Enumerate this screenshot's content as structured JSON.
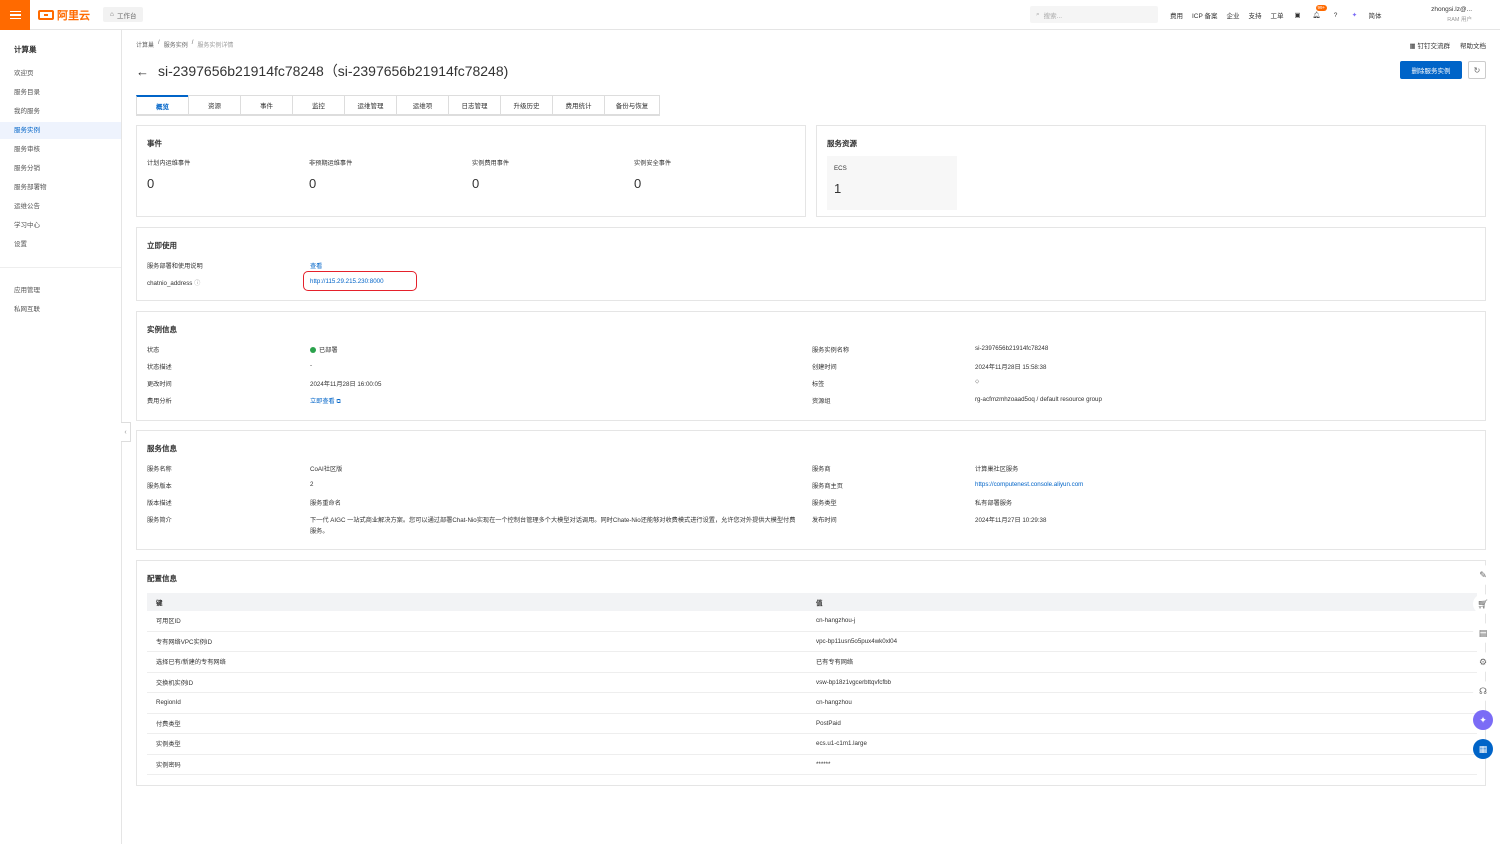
{
  "topbar": {
    "logo_text": "阿里云",
    "workbench_label": "工作台",
    "search_placeholder": "搜索...",
    "nav": [
      "费用",
      "ICP 备案",
      "企业",
      "支持",
      "工单"
    ],
    "notify_badge": "99+",
    "lang": "简体",
    "user_name": "zhongsi.lz@...",
    "user_role": "RAM 用户"
  },
  "sidebar": {
    "title": "计算巢",
    "items": [
      "欢迎页",
      "服务目录",
      "我的服务",
      "服务实例",
      "服务审核",
      "服务分销",
      "服务部署物",
      "运维公告",
      "学习中心",
      "设置"
    ],
    "active_index": 3,
    "extra_items": [
      "应用管理",
      "私网互联"
    ]
  },
  "breadcrumb": [
    "计算巢",
    "服务实例",
    "服务实例详情"
  ],
  "header_links": [
    "钉钉交流群",
    "帮助文档"
  ],
  "page_title": "si-2397656b21914fc78248（si-2397656b21914fc78248)",
  "delete_button": "删除服务实例",
  "tabs": [
    "概览",
    "资源",
    "事件",
    "监控",
    "运维管理",
    "运维项",
    "日志管理",
    "升级历史",
    "费用统计",
    "备份与恢复"
  ],
  "events": {
    "title": "事件",
    "items": [
      {
        "label": "计划内运维事件",
        "value": "0"
      },
      {
        "label": "非预期运维事件",
        "value": "0"
      },
      {
        "label": "实例费用事件",
        "value": "0"
      },
      {
        "label": "实例安全事件",
        "value": "0"
      }
    ]
  },
  "resources": {
    "title": "服务资源",
    "ecs_label": "ECS",
    "ecs_value": "1"
  },
  "quickuse": {
    "title": "立即使用",
    "guide_label": "服务部署和使用说明",
    "guide_link": "查看",
    "address_label": "chatnio_address",
    "address_value": "http://115.29.215.230:8000"
  },
  "instance": {
    "title": "实例信息",
    "left": [
      {
        "label": "状态",
        "value": "已部署"
      },
      {
        "label": "状态描述",
        "value": "-"
      },
      {
        "label": "更改时间",
        "value": "2024年11月28日 16:00:05"
      },
      {
        "label": "费用分析",
        "value": "立即查看"
      }
    ],
    "right": [
      {
        "label": "服务实例名称",
        "value": "si-2397656b21914fc78248"
      },
      {
        "label": "创建时间",
        "value": "2024年11月28日 15:58:38"
      },
      {
        "label": "标签",
        "value": ""
      },
      {
        "label": "资源组",
        "value": "rg-acfmzmhzoaad5oq / default resource group"
      }
    ]
  },
  "service": {
    "title": "服务信息",
    "left": [
      {
        "label": "服务名称",
        "value": "CoAI社区版"
      },
      {
        "label": "服务版本",
        "value": "2"
      },
      {
        "label": "版本描述",
        "value": "服务重命名"
      },
      {
        "label": "服务简介",
        "value": "下一代 AIGC 一站式商业解决方案。您可以通过部署Chat-Nio实现在一个控制台管理多个大模型对话调用。同时Chate-Nio还能够对收费模式进行设置，允许您对外提供大模型付费服务。"
      }
    ],
    "right": [
      {
        "label": "服务商",
        "value": "计算巢社区服务"
      },
      {
        "label": "服务商主页",
        "value": "https://computenest.console.aliyun.com"
      },
      {
        "label": "服务类型",
        "value": "私有部署服务"
      },
      {
        "label": "发布时间",
        "value": "2024年11月27日 10:29:38"
      }
    ]
  },
  "config": {
    "title": "配置信息",
    "col_key": "键",
    "col_value": "值",
    "rows": [
      [
        "可用区ID",
        "cn-hangzhou-j"
      ],
      [
        "专有网络VPC实例ID",
        "vpc-bp11usn5o5pux4wk0xl04"
      ],
      [
        "选择已有/新建的专有网络",
        "已有专有网络"
      ],
      [
        "交换机实例ID",
        "vsw-bp18z1vgcerbttqvfcfbb"
      ],
      [
        "RegionId",
        "cn-hangzhou"
      ],
      [
        "付费类型",
        "PostPaid"
      ],
      [
        "实例类型",
        "ecs.u1-c1m1.large"
      ],
      [
        "实例密码",
        "******"
      ]
    ]
  }
}
